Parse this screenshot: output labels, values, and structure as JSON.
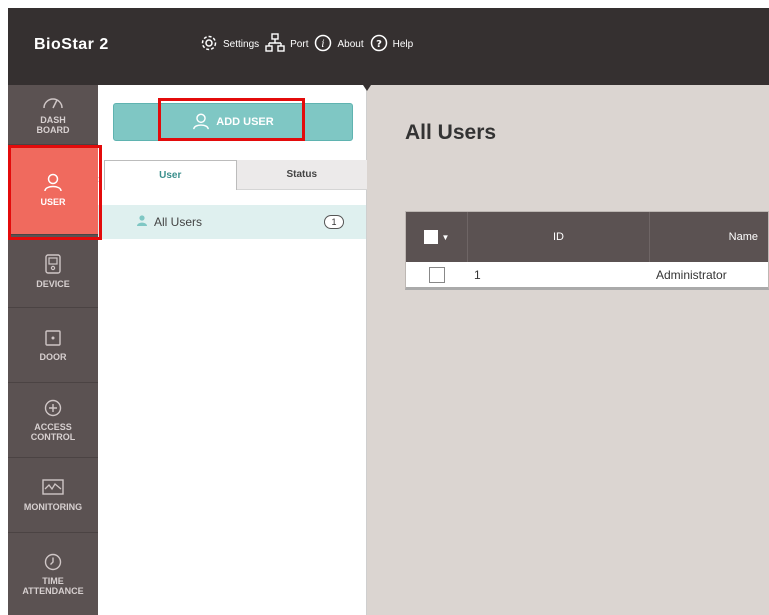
{
  "app": {
    "brand": "BioStar 2"
  },
  "topnav": [
    {
      "label": "Settings",
      "icon": "gear-icon"
    },
    {
      "label": "Port",
      "icon": "network-icon"
    },
    {
      "label": "About",
      "icon": "info-icon"
    },
    {
      "label": "Help",
      "icon": "help-icon"
    }
  ],
  "leftnav": {
    "dashboard": "DASH\nBOARD",
    "user": "USER",
    "device": "DEVICE",
    "door": "DOOR",
    "access_control": "ACCESS\nCONTROL",
    "monitoring": "MONITORING",
    "time_attendance": "TIME\nATTENDANCE"
  },
  "panel": {
    "add_user_label": "ADD USER",
    "tabs": [
      "User",
      "Status"
    ],
    "group": {
      "label": "All Users",
      "count": "1"
    }
  },
  "main": {
    "title": "All Users",
    "columns": [
      "ID",
      "Name"
    ],
    "rows": [
      {
        "id": "1",
        "name": "Administrator"
      }
    ]
  },
  "colors": {
    "topbar": "#353030",
    "leftnav": "#5b5252",
    "active_nav": "#f06a5e",
    "add_button": "#7fc7c4",
    "highlight": "#e30b0b",
    "main_bg": "#dbd5d1"
  }
}
